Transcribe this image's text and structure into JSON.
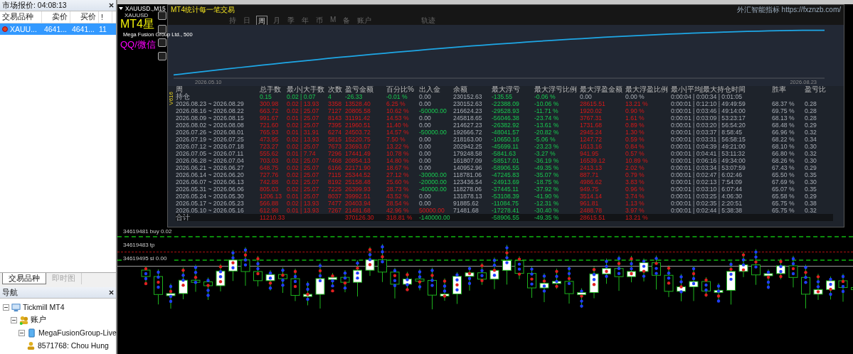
{
  "market_watch": {
    "title": "市场报价: 04:08:13",
    "columns": [
      "交易品种",
      "卖价",
      "买价",
      "!"
    ],
    "rows": [
      {
        "symbol": "XAUU...",
        "bid": "4641...",
        "ask": "4641...",
        "spread": "11",
        "selected": true
      }
    ],
    "tabs": [
      {
        "label": "交易品种",
        "selected": true
      },
      {
        "label": "即时图",
        "selected": false
      }
    ]
  },
  "navigator": {
    "title": "导航",
    "tree": [
      {
        "label": "Tickmill MT4",
        "kind": "terminal",
        "expanded": true,
        "children": [
          {
            "label": "账户",
            "kind": "accounts",
            "expanded": true,
            "children": [
              {
                "label": "MegaFusionGroup-Live",
                "kind": "server",
                "expanded": true,
                "children": [
                  {
                    "label": "8571768: Chou Hung",
                    "kind": "account"
                  }
                ]
              }
            ]
          }
        ]
      }
    ]
  },
  "chart": {
    "title": "XAUUSD.,M15",
    "symbol": "XAUUSD",
    "overlay_title": "MT4星",
    "broker": "Mega Fusion Group Ltd., 500",
    "contact": "QQ/微信",
    "order_lines": [
      {
        "label": "34619481 buy 0.02",
        "kind": "entry"
      },
      {
        "label": "34619483 tp",
        "kind": "tp"
      },
      {
        "label": "34619495 sl 0.00",
        "kind": "entry"
      }
    ]
  },
  "stats_panel": {
    "title": "MT4统计每一笔交易",
    "link": "外汇智能指标 https://fxznzb.com/",
    "version": "V616",
    "tabs": [
      {
        "label": "持",
        "selected": false
      },
      {
        "label": "日",
        "selected": false
      },
      {
        "label": "周",
        "selected": true
      },
      {
        "label": "月",
        "selected": false
      },
      {
        "label": "季",
        "selected": false
      },
      {
        "label": "年",
        "selected": false
      },
      {
        "label": "币",
        "selected": false
      },
      {
        "label": "M",
        "selected": false
      },
      {
        "label": "备",
        "selected": false
      },
      {
        "label": "账户",
        "selected": false
      }
    ],
    "extra_tab": "轨迹",
    "curve_start": "2026.05.10",
    "curve_end": "2026.08.23",
    "columns": [
      "周",
      "总手数",
      "最小|大手数",
      "次数",
      "盈亏金额",
      "百分比%",
      "出入金",
      "余额",
      "最大浮亏",
      "最大浮亏比例",
      "最大浮盈金额",
      "最大浮盈比例",
      "最小|平均|最大持仓时间",
      "胜率",
      "盈亏比"
    ],
    "rows": [
      {
        "kind": "position",
        "cells": [
          "持仓",
          "0.15",
          "0.02 | 0.07",
          "4",
          "-26.33",
          "-0.01 %",
          "0.00",
          "230152.63",
          "-135.55",
          "-0.06 %",
          "0.00",
          "0.00 %",
          "0:00:04 | 0:00:34 | 0:01:05",
          "",
          ""
        ]
      },
      {
        "kind": "week",
        "cells": [
          "2026.08.23 ~ 2026.08.29",
          "300.98",
          "0.02 | 13.93",
          "3358",
          "13528.40",
          "6.25 %",
          "0.00",
          "230152.63",
          "-22388.09",
          "-10.06 %",
          "28615.51",
          "13.21 %",
          "0:00:01 | 0:12:10 | 49:49:59",
          "68.37 %",
          "0.28"
        ]
      },
      {
        "kind": "withdrawal",
        "cells": [
          "2026.08.16 ~ 2026.08.22",
          "663.72",
          "0.02 | 25.07",
          "7127",
          "20805.58",
          "10.62 %",
          "-50000.00",
          "216624.23",
          "-29528.93",
          "-11.71 %",
          "1920.02",
          "0.90 %",
          "0:00:01 | 0:03:46 | 49:14:00",
          "69.75 %",
          "0.28"
        ]
      },
      {
        "kind": "week",
        "cells": [
          "2026.08.09 ~ 2026.08.15",
          "991.67",
          "0.01 | 25.07",
          "8143",
          "31191.42",
          "14.53 %",
          "0.00",
          "245818.65",
          "-56046.38",
          "-23.74 %",
          "3767.31",
          "1.61 %",
          "0:00:01 | 0:03:09 | 53:23:17",
          "68.13 %",
          "0.28"
        ]
      },
      {
        "kind": "week",
        "cells": [
          "2026.08.02 ~ 2026.08.08",
          "721.60",
          "0.02 | 25.07",
          "7395",
          "21960.51",
          "11.40 %",
          "0.00",
          "214627.23",
          "-26382.92",
          "-13.61 %",
          "1731.68",
          "0.89 %",
          "0:00:01 | 0:03:20 | 56:54:20",
          "68.48 %",
          "0.29"
        ]
      },
      {
        "kind": "withdrawal",
        "cells": [
          "2026.07.26 ~ 2026.08.01",
          "765.93",
          "0.01 | 31.91",
          "6274",
          "24503.72",
          "14.57 %",
          "-50000.00",
          "192666.72",
          "-48041.57",
          "-20.82 %",
          "2945.24",
          "1.30 %",
          "0:00:01 | 0:03:37 | 8:58:45",
          "66.96 %",
          "0.32"
        ]
      },
      {
        "kind": "week",
        "cells": [
          "2026.07.19 ~ 2026.07.25",
          "473.95",
          "0.02 | 13.93",
          "5815",
          "15220.75",
          "7.50 %",
          "0.00",
          "218163.00",
          "-10650.16",
          "-5.06 %",
          "1247.72",
          "0.59 %",
          "0:00:01 | 0:03:31 | 56:58:15",
          "68.22 %",
          "0.34"
        ]
      },
      {
        "kind": "week",
        "cells": [
          "2026.07.12 ~ 2026.07.18",
          "723.27",
          "0.02 | 25.07",
          "7673",
          "23693.67",
          "13.22 %",
          "0.00",
          "202942.25",
          "-45699.11",
          "-23.23 %",
          "1613.16",
          "0.84 %",
          "0:00:01 | 0:04:39 | 49:21:00",
          "68.10 %",
          "0.30"
        ]
      },
      {
        "kind": "week",
        "cells": [
          "2026.07.05 ~ 2026.07.11",
          "555.62",
          "0.01 | 7.74",
          "7296",
          "17441.49",
          "10.78 %",
          "0.00",
          "179248.58",
          "-5841.63",
          "-3.27 %",
          "941.95",
          "0.57 %",
          "0:00:01 | 0:04:41 | 53:11:32",
          "66.80 %",
          "0.32"
        ]
      },
      {
        "kind": "week",
        "cells": [
          "2026.06.28 ~ 2026.07.04",
          "703.03",
          "0.02 | 25.07",
          "7468",
          "20854.13",
          "14.80 %",
          "0.00",
          "161807.09",
          "-58517.01",
          "-36.19 %",
          "16539.12",
          "10.89 %",
          "0:00:01 | 0:06:16 | 49:34:00",
          "68.26 %",
          "0.30"
        ]
      },
      {
        "kind": "week",
        "cells": [
          "2026.06.21 ~ 2026.06.27",
          "648.75",
          "0.02 | 25.07",
          "6166",
          "22171.90",
          "18.67 %",
          "0.00",
          "140952.96",
          "-58906.55",
          "-49.35 %",
          "2413.13",
          "2.02 %",
          "0:00:01 | 0:03:34 | 53:07:59",
          "67.43 %",
          "0.29"
        ]
      },
      {
        "kind": "withdrawal",
        "cells": [
          "2026.06.14 ~ 2026.06.20",
          "727.76",
          "0.02 | 25.07",
          "7115",
          "25344.52",
          "27.12 %",
          "-30000.00",
          "118781.06",
          "-47245.83",
          "-35.07 %",
          "887.71",
          "0.79 %",
          "0:00:01 | 0:02:47 | 6:02:46",
          "65.50 %",
          "0.35"
        ]
      },
      {
        "kind": "withdrawal",
        "cells": [
          "2026.06.07 ~ 2026.06.13",
          "742.88",
          "0.02 | 25.07",
          "8192",
          "25158.48",
          "25.60 %",
          "-20000.00",
          "123436.54",
          "-24913.69",
          "-18.75 %",
          "4986.62",
          "3.83 %",
          "0:00:01 | 0:02:13 | 7:54:09",
          "67.69 %",
          "0.30"
        ]
      },
      {
        "kind": "withdrawal",
        "cells": [
          "2026.05.31 ~ 2026.06.06",
          "805.03",
          "0.02 | 25.07",
          "7225",
          "26399.93",
          "28.73 %",
          "-40000.00",
          "118278.06",
          "-37445.11",
          "-37.92 %",
          "949.75",
          "0.96 %",
          "0:00:01 | 0:03:10 | 6:07:44",
          "65.07 %",
          "0.35"
        ]
      },
      {
        "kind": "week",
        "cells": [
          "2026.05.24 ~ 2026.05.30",
          "1206.13",
          "0.01 | 25.07",
          "8037",
          "39992.51",
          "43.52 %",
          "0.00",
          "131878.13",
          "-53108.39",
          "-41.90 %",
          "3514.14",
          "3.74 %",
          "0:00:01 | 0:03:25 | 4:06:30",
          "65.58 %",
          "0.29"
        ]
      },
      {
        "kind": "week",
        "cells": [
          "2026.05.17 ~ 2026.05.23",
          "566.88",
          "0.02 | 13.93",
          "7477",
          "20403.94",
          "28.54 %",
          "0.00",
          "91885.62",
          "-11084.75",
          "-12.31 %",
          "961.81",
          "1.13 %",
          "0:00:01 | 0:02:35 | 2:20:51",
          "65.75 %",
          "0.38"
        ]
      },
      {
        "kind": "deposit",
        "cells": [
          "2026.05.10 ~ 2026.05.16",
          "612.98",
          "0.01 | 13.93",
          "7267",
          "21481.68",
          "42.96 %",
          "50000.00",
          "71481.68",
          "-17278.41",
          "-30.40 %",
          "2488.78",
          "3.97 %",
          "0:00:01 | 0:02:44 | 5:38:38",
          "65.75 %",
          "0.32"
        ]
      },
      {
        "kind": "total",
        "cells": [
          "合计",
          "11210.33",
          "",
          "",
          "370126.30",
          "318.81 %",
          "-140000.00",
          "",
          "-58906.55",
          "-49.35 %",
          "28615.51",
          "13.21 %",
          "",
          "",
          ""
        ]
      }
    ]
  }
}
